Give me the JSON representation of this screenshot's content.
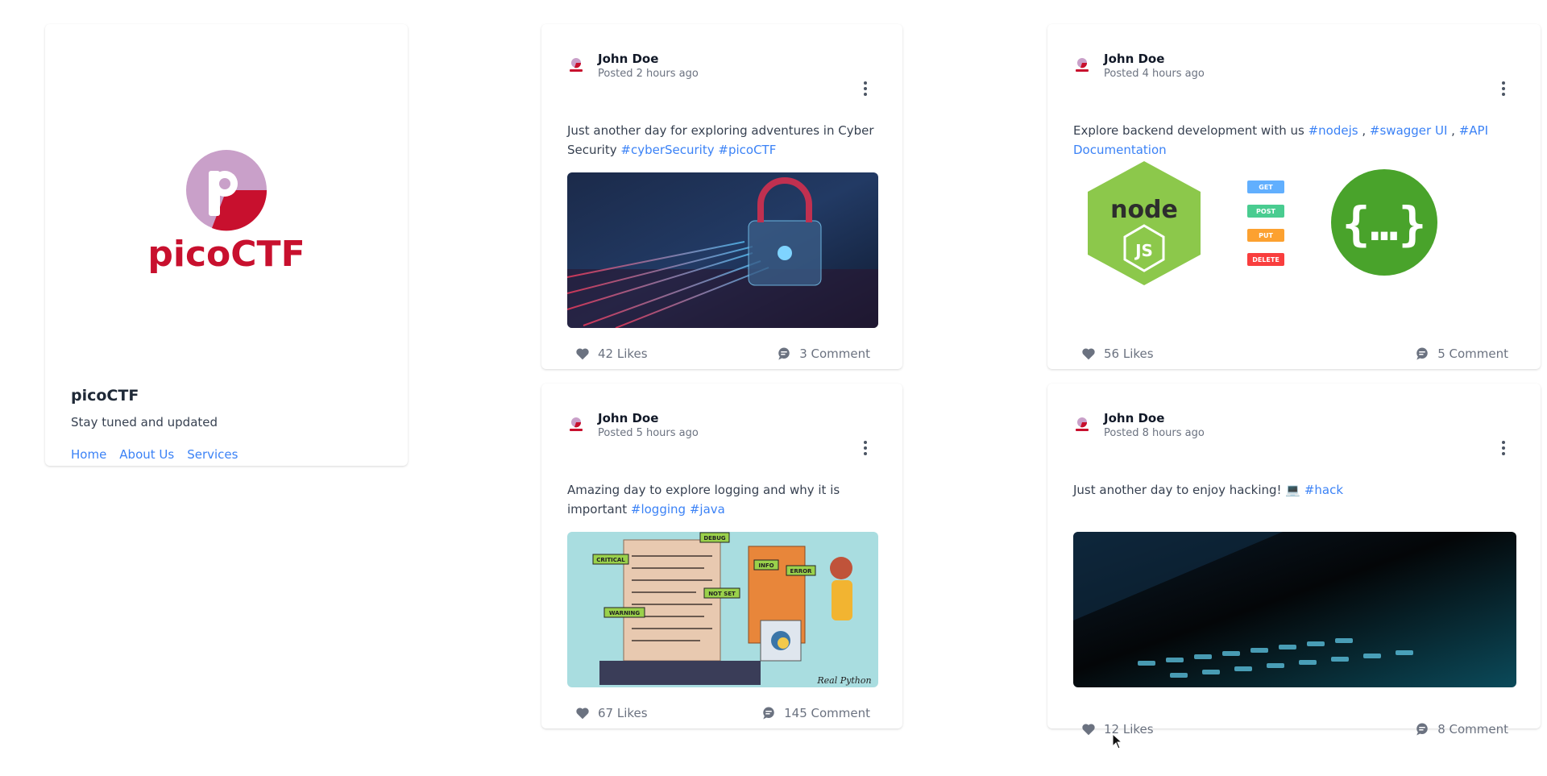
{
  "profile": {
    "logo_text": "picoCTF",
    "name": "picoCTF",
    "tagline": "Stay tuned and updated",
    "links": [
      "Home",
      "About Us",
      "Services"
    ]
  },
  "posts": [
    {
      "author": "John Doe",
      "time": "Posted 2 hours ago",
      "text": "Just another day for exploring adventures in Cyber Security",
      "tags": [
        "#cyberSecurity",
        "#picoCTF"
      ],
      "media": "cyber-lock-image",
      "likes": "42 Likes",
      "comments": "3 Comment"
    },
    {
      "author": "John Doe",
      "time": "Posted 4 hours ago",
      "text": "Explore backend development with us",
      "tags": [
        "#nodejs",
        "#swagger UI",
        "#API Documentation"
      ],
      "media": "nodejs-swagger-icons",
      "media_labels": [
        "GET",
        "POST",
        "PUT",
        "DELETE"
      ],
      "likes": "56 Likes",
      "comments": "5 Comment"
    },
    {
      "author": "John Doe",
      "time": "Posted 5 hours ago",
      "text": "Amazing day to explore logging and why it is important",
      "tags": [
        "#logging",
        "#java"
      ],
      "media": "logging-illustration",
      "media_labels": [
        "DEBUG",
        "CRITICAL",
        "INFO",
        "ERROR",
        "NOT SET",
        "WARNING",
        "Real Python"
      ],
      "likes": "67 Likes",
      "comments": "145 Comment"
    },
    {
      "author": "John Doe",
      "time": "Posted 8 hours ago",
      "text": "Just another day to enjoy hacking! 💻",
      "tags": [
        "#hack"
      ],
      "media": "keyboard-image",
      "likes": "12 Likes",
      "comments": "8 Comment"
    }
  ],
  "colors": {
    "brand": "#c8102e",
    "logo_circle": "#c9a0c9",
    "link": "#3b82f6",
    "node_green": "#8cc84b",
    "swagger_green": "#49a32b"
  }
}
